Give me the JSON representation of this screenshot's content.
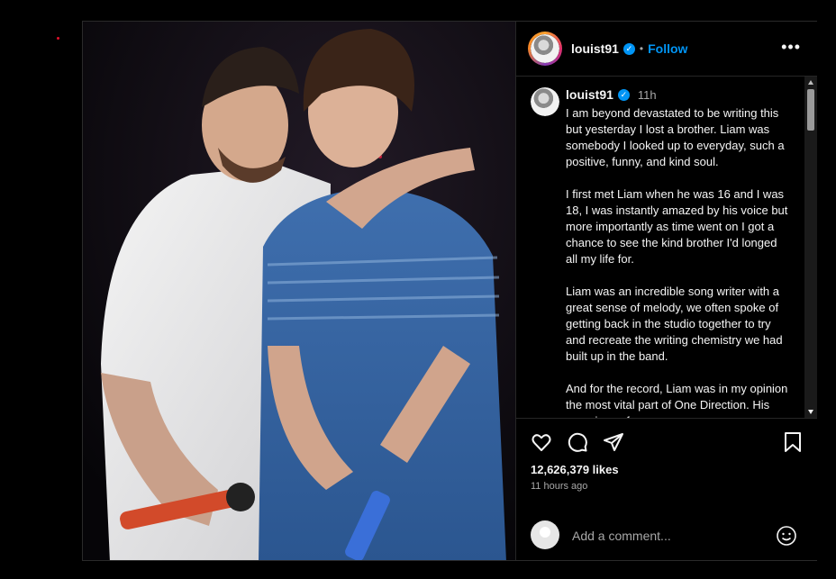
{
  "post": {
    "username": "louist91",
    "follow_label": "Follow",
    "separator": "•",
    "more_label": "•••",
    "verified_glyph": "✓",
    "caption_time": "11h",
    "caption_paragraphs": [
      "I am beyond devastated to be writing this but yesterday I lost a brother. Liam was somebody I looked up to everyday, such a positive, funny, and kind soul.",
      "I first met Liam when he was 16 and I was 18, I was instantly amazed by his voice but more importantly as time went on I got a chance to see the kind brother I'd longed all my life for.",
      "Liam was an incredible song writer with a great sense of melody, we often spoke of getting back in the studio together to try and recreate the writing chemistry we had built up in the band.",
      "And for the record, Liam was in my opinion the most vital part of One Direction. His experience from a young"
    ],
    "likes": "12,626,379 likes",
    "posted_ago": "11 hours ago",
    "comment_placeholder": "Add a comment..."
  },
  "icons": {
    "like": "heart-icon",
    "comment": "comment-icon",
    "share": "share-icon",
    "save": "bookmark-icon",
    "emoji": "smiley-icon",
    "more": "more-dots-icon"
  },
  "colors": {
    "accent": "#0095f6",
    "background": "#000000",
    "border": "#262626",
    "muted": "#a8a8a8"
  }
}
